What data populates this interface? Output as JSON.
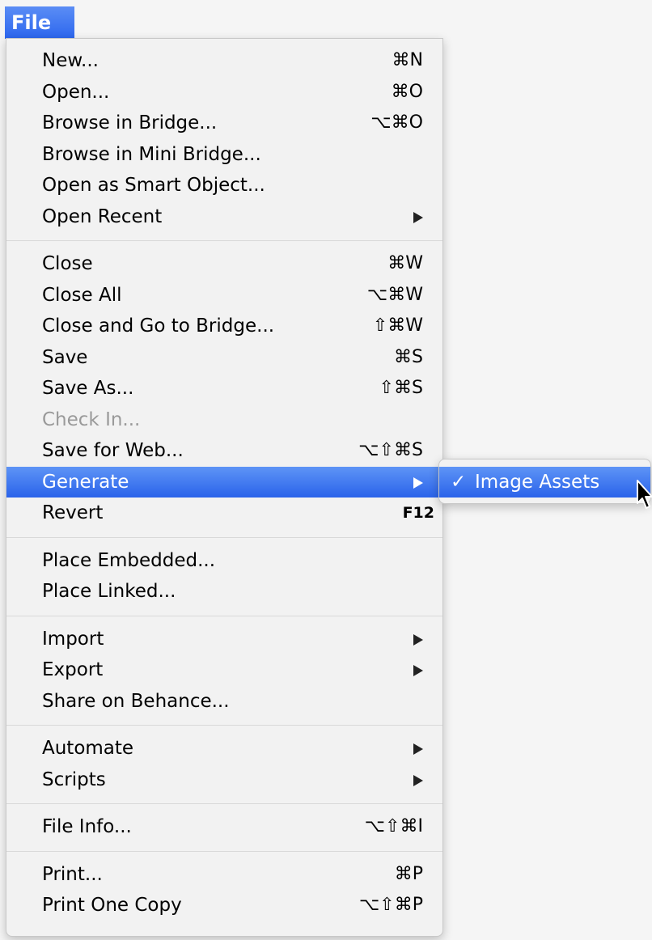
{
  "menu_bar": {
    "title": "File"
  },
  "file_menu": {
    "items": [
      {
        "label": "New...",
        "shortcut": "⌘N"
      },
      {
        "label": "Open...",
        "shortcut": "⌘O"
      },
      {
        "label": "Browse in Bridge...",
        "shortcut": "⌥⌘O"
      },
      {
        "label": "Browse in Mini Bridge...",
        "shortcut": ""
      },
      {
        "label": "Open as Smart Object...",
        "shortcut": ""
      },
      {
        "label": "Open Recent",
        "submenu": true
      },
      {
        "separator": true
      },
      {
        "label": "Close",
        "shortcut": "⌘W"
      },
      {
        "label": "Close All",
        "shortcut": "⌥⌘W"
      },
      {
        "label": "Close and Go to Bridge...",
        "shortcut": "⇧⌘W"
      },
      {
        "label": "Save",
        "shortcut": "⌘S"
      },
      {
        "label": "Save As...",
        "shortcut": "⇧⌘S"
      },
      {
        "label": "Check In...",
        "disabled": true
      },
      {
        "label": "Save for Web...",
        "shortcut": "⌥⇧⌘S"
      },
      {
        "label": "Generate",
        "submenu": true,
        "highlighted": true
      },
      {
        "label": "Revert",
        "shortcut": "F12"
      },
      {
        "separator": true
      },
      {
        "label": "Place Embedded...",
        "shortcut": ""
      },
      {
        "label": "Place Linked...",
        "shortcut": ""
      },
      {
        "separator": true
      },
      {
        "label": "Import",
        "submenu": true
      },
      {
        "label": "Export",
        "submenu": true
      },
      {
        "label": "Share on Behance...",
        "shortcut": ""
      },
      {
        "separator": true
      },
      {
        "label": "Automate",
        "submenu": true
      },
      {
        "label": "Scripts",
        "submenu": true
      },
      {
        "separator": true
      },
      {
        "label": "File Info...",
        "shortcut": "⌥⇧⌘I"
      },
      {
        "separator": true
      },
      {
        "label": "Print...",
        "shortcut": "⌘P"
      },
      {
        "label": "Print One Copy",
        "shortcut": "⌥⇧⌘P"
      }
    ]
  },
  "generate_submenu": {
    "check": "✓",
    "label": "Image Assets",
    "checked": true
  },
  "colors": {
    "highlight": "#2a63ea",
    "menu_background": "#f2f2f2",
    "disabled_text": "#9a9a9a"
  }
}
